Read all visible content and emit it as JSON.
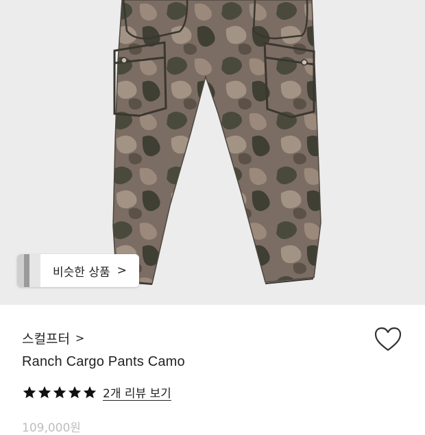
{
  "product": {
    "brand": "스컬프터",
    "title": "Ranch Cargo Pants Camo",
    "rating_stars": 5,
    "review_link": "2개 리뷰 보기",
    "price": "109,000원"
  },
  "similar_chip": {
    "label": "비슷한 상품",
    "arrow": ">"
  },
  "icons": {
    "brand_chevron": ">",
    "favorite": "heart-icon",
    "star": "star-icon"
  },
  "colors": {
    "hero_bg": "#ececec",
    "text": "#222222",
    "muted_price": "#bdbdbd",
    "star": "#111111"
  }
}
